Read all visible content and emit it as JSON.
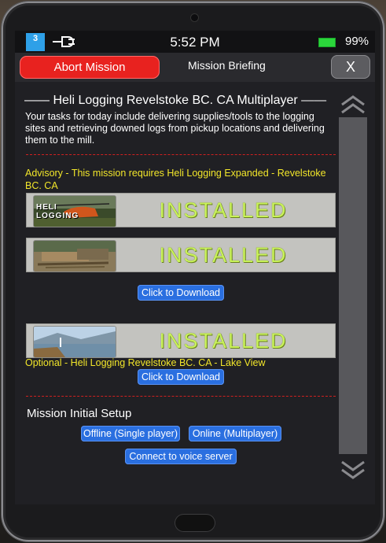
{
  "status": {
    "time": "5:52 PM",
    "battery_pct": "99%",
    "battery_level": 0.99,
    "app_badge": "3"
  },
  "header": {
    "abort_label": "Abort Mission",
    "title": "Mission Briefing",
    "close_label": "X"
  },
  "mission": {
    "title": "—— Heli Logging Revelstoke BC. CA Multiplayer ——",
    "description": "Your tasks for today include delivering supplies/tools to the logging sites and retrieving downed logs from pickup locations and delivering them to the mill."
  },
  "advisory": {
    "text": "Advisory - This mission requires Heli Logging Expanded - Revelstoke BC. CA",
    "items": [
      {
        "status": "INSTALLED",
        "thumb_text": "HELI LOGGING"
      },
      {
        "status": "INSTALLED"
      }
    ],
    "download_label": "Click to Download"
  },
  "optional": {
    "text": "Optional - Heli Logging Revelstoke BC. CA - Lake View",
    "items": [
      {
        "status": "INSTALLED"
      }
    ],
    "download_label": "Click to Download"
  },
  "setup": {
    "title": "Mission Initial Setup",
    "offline_label": "Offline (Single player)",
    "online_label": "Online (Multiplayer)",
    "voice_label": "Connect to voice server"
  },
  "colors": {
    "abort": "#e8221f",
    "accent_blue": "#2a6fe0",
    "advisory_yellow": "#f2e62a",
    "installed_green": "#c9f25a",
    "divider_red": "#d02020",
    "battery_green": "#2bd63b"
  }
}
